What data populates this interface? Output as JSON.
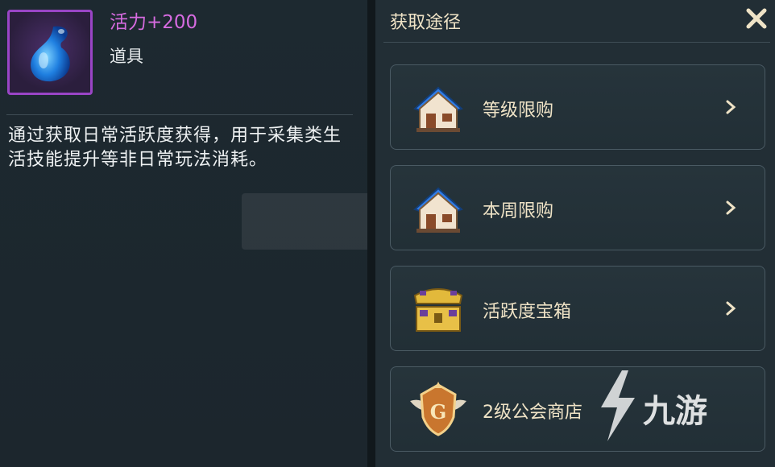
{
  "item": {
    "name": "活力+200",
    "type": "道具",
    "description": "通过获取日常活跃度获得，用于采集类生活技能提升等非日常玩法消耗。",
    "icon": "blue-droplet-icon",
    "frame_color": "#9a45c6"
  },
  "acquisition": {
    "title": "获取途径",
    "close_icon": "close-icon",
    "sources": [
      {
        "label": "等级限购",
        "icon": "shop-house-icon"
      },
      {
        "label": "本周限购",
        "icon": "shop-house-icon"
      },
      {
        "label": "活跃度宝箱",
        "icon": "treasure-chest-icon"
      },
      {
        "label": "2级公会商店",
        "icon": "guild-emblem-icon"
      }
    ]
  },
  "watermark": {
    "text": "九游"
  },
  "colors": {
    "item_name": "#d66be0",
    "gold_text": "#efe3c6",
    "panel_bg": "#222e35"
  }
}
